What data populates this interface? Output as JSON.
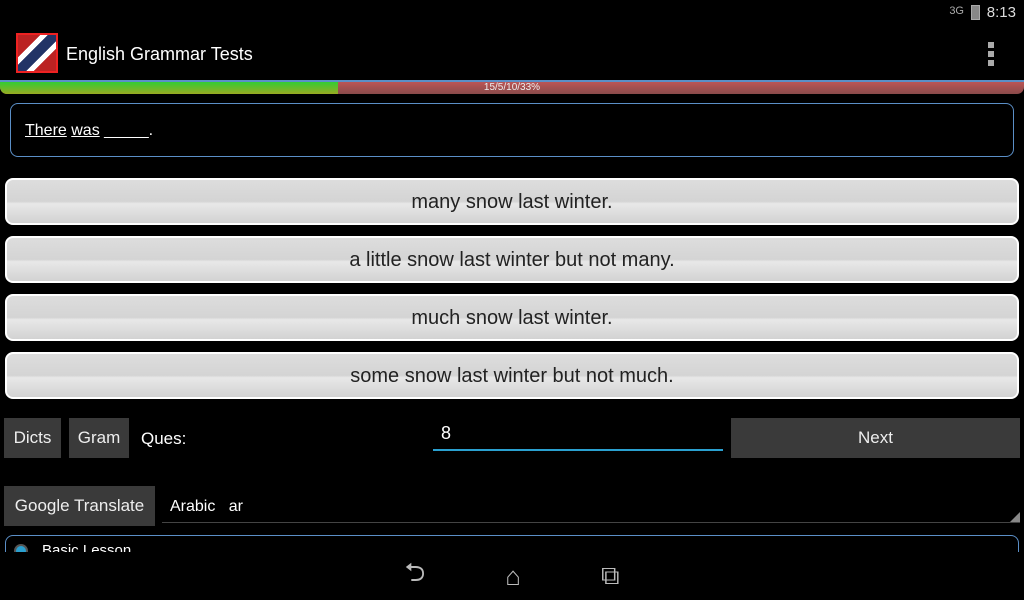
{
  "status": {
    "clock": "8:13",
    "network": "3G"
  },
  "app": {
    "title": "English Grammar Tests",
    "logo_icon": "us-uk-flag-icon"
  },
  "progress": {
    "label": "15/5/10/33%",
    "percent": 33,
    "fill_color": "#33cc33",
    "track_color": "#a05050"
  },
  "question": {
    "word1": "There",
    "word2": "was",
    "blank": "_____",
    "end": "."
  },
  "answers": [
    "many snow last winter.",
    "a little snow last winter but not many.",
    "much snow last winter.",
    "some snow last winter but not much."
  ],
  "controls": {
    "dicts": "Dicts",
    "gram": "Gram",
    "ques_label": "Ques:",
    "ques_value": "8",
    "next": "Next"
  },
  "translate": {
    "button": "Google Translate",
    "language": "Arabic   ar"
  },
  "lesson": {
    "option": "Basic Lesson"
  },
  "nav": {
    "back": "back-icon",
    "home": "home-icon",
    "recents": "recents-icon"
  }
}
